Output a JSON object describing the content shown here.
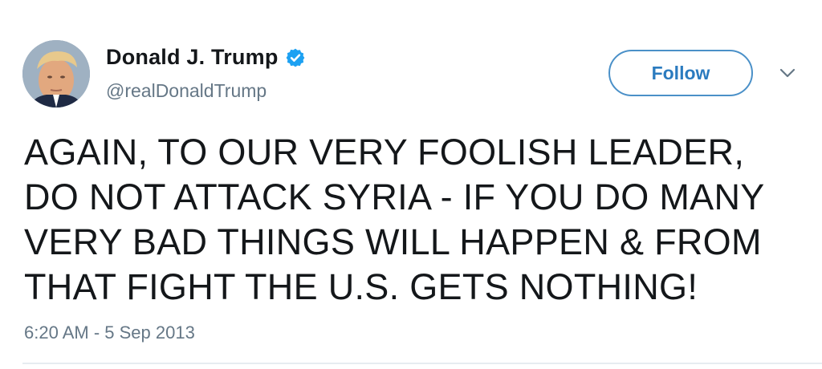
{
  "user": {
    "display_name": "Donald J. Trump",
    "handle": "@realDonaldTrump",
    "verified_icon": "verified-badge-icon",
    "avatar_icon": "profile-photo"
  },
  "actions": {
    "follow_label": "Follow",
    "more_icon": "chevron-down-icon"
  },
  "tweet": {
    "text": "AGAIN, TO OUR VERY FOOLISH LEADER,\nDO NOT ATTACK SYRIA - IF YOU DO MANY\nVERY BAD THINGS WILL HAPPEN & FROM\nTHAT FIGHT THE U.S. GETS NOTHING!",
    "timestamp": "6:20 AM - 5 Sep 2013"
  },
  "colors": {
    "accent": "#1da1f2",
    "follow_border": "#4a90c8",
    "muted_text": "#657786",
    "body_text": "#14171a"
  }
}
